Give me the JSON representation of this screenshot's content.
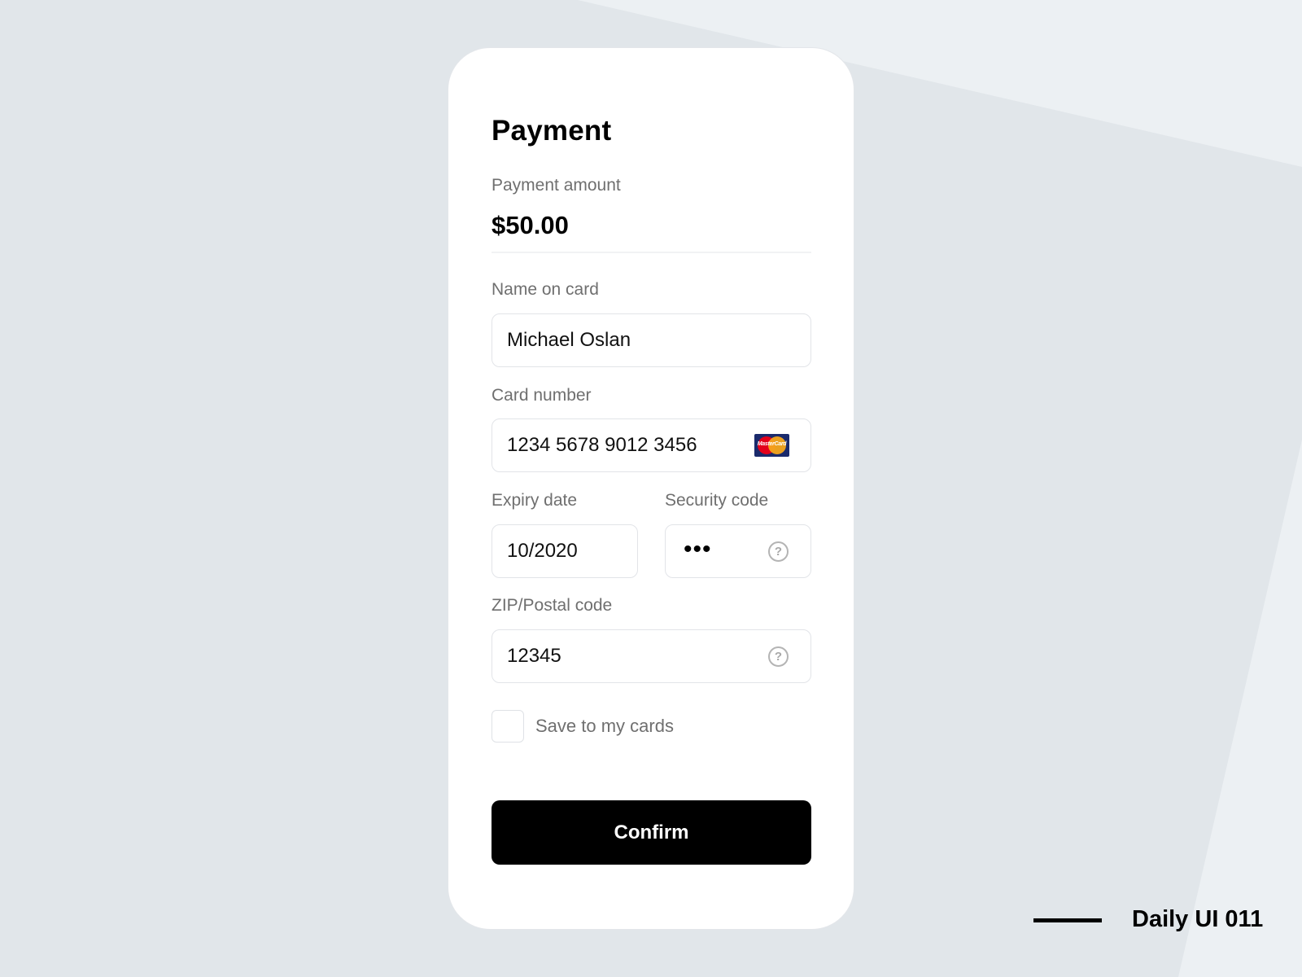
{
  "card": {
    "title": "Payment",
    "amount_label": "Payment amount",
    "amount_value": "$50.00",
    "name_label": "Name on card",
    "name_value": "Michael Oslan",
    "card_number_label": "Card number",
    "card_number_value": "1234 5678 9012 3456",
    "card_brand": "MasterCard",
    "expiry_label": "Expiry date",
    "expiry_value": "10/2020",
    "security_label": "Security code",
    "security_value": "•••",
    "zip_label": "ZIP/Postal code",
    "zip_value": "12345",
    "help_glyph": "?",
    "save_label": "Save to my cards",
    "save_checked": false,
    "confirm_label": "Confirm"
  },
  "footer": {
    "text": "Daily UI 011"
  },
  "colors": {
    "background": "#e1e6ea",
    "accent": "#000000",
    "label": "#6f6f6f"
  }
}
